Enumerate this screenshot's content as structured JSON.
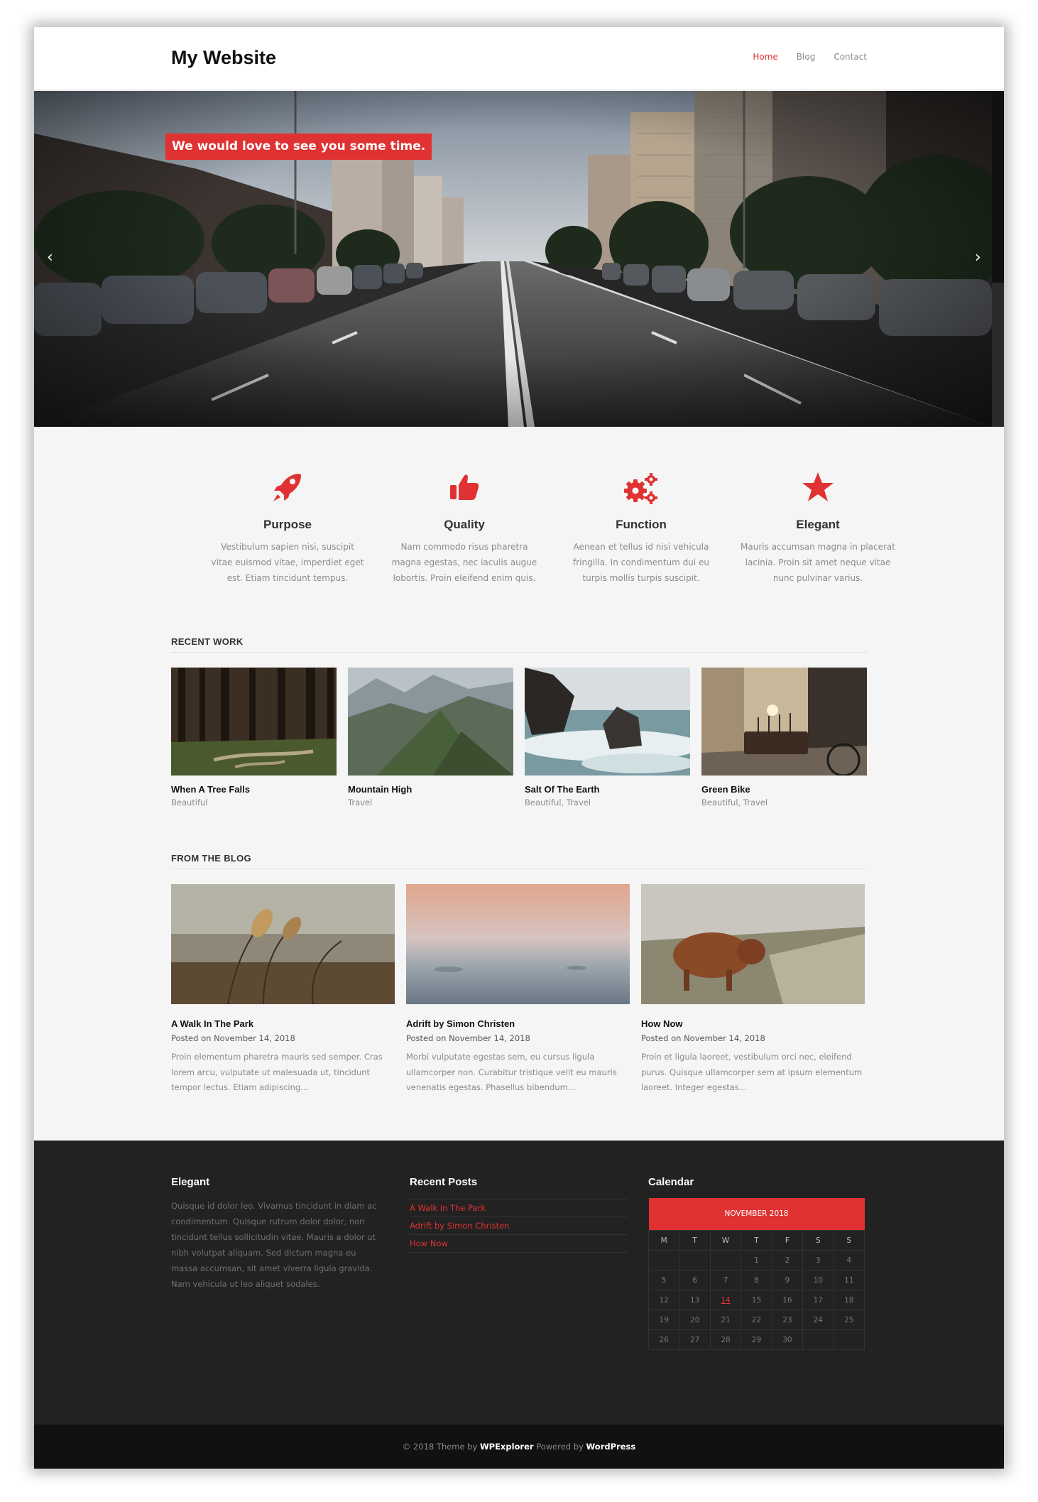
{
  "header": {
    "site_title": "My Website",
    "nav": [
      "Home",
      "Blog",
      "Contact"
    ]
  },
  "hero": {
    "caption": "We would love to see you some time.",
    "prev_icon": "chevron-left-icon",
    "next_icon": "chevron-right-icon"
  },
  "features": [
    {
      "icon": "rocket-icon",
      "title": "Purpose",
      "text": "Vestibulum sapien nisi, suscipit vitae euismod vitae, imperdiet eget est. Etiam tincidunt tempus."
    },
    {
      "icon": "thumbs-up-icon",
      "title": "Quality",
      "text": "Nam commodo risus pharetra magna egestas, nec iaculis augue lobortis. Proin eleifend enim quis."
    },
    {
      "icon": "gears-icon",
      "title": "Function",
      "text": "Aenean et tellus id nisi vehicula fringilla. In condimentum dui eu turpis mollis turpis suscipit."
    },
    {
      "icon": "star-icon",
      "title": "Elegant",
      "text": "Mauris accumsan magna in placerat lacinia. Proin sit amet neque vitae nunc pulvinar varius."
    }
  ],
  "recent_work": {
    "heading": "RECENT WORK",
    "items": [
      {
        "title": "When A Tree Falls",
        "cats": "Beautiful"
      },
      {
        "title": "Mountain High",
        "cats": "Travel"
      },
      {
        "title": "Salt Of The Earth",
        "cats": "Beautiful, Travel"
      },
      {
        "title": "Green Bike",
        "cats": "Beautiful, Travel"
      }
    ]
  },
  "blog": {
    "heading": "FROM THE BLOG",
    "posts": [
      {
        "title": "A Walk In The Park",
        "meta": "Posted on November 14, 2018",
        "excerpt": "Proin elementum pharetra mauris sed semper. Cras lorem arcu, vulputate ut malesuada ut, tincidunt tempor lectus. Etiam adipiscing..."
      },
      {
        "title": "Adrift by Simon Christen",
        "meta": "Posted on November 14, 2018",
        "excerpt": "Morbi vulputate egestas sem, eu cursus ligula ullamcorper non. Curabitur tristique velit eu mauris venenatis egestas. Phasellus bibendum..."
      },
      {
        "title": "How Now",
        "meta": "Posted on November 14, 2018",
        "excerpt": "Proin et ligula laoreet, vestibulum orci nec, eleifend purus. Quisque ullamcorper sem at ipsum elementum laoreet. Integer egestas..."
      }
    ]
  },
  "footer": {
    "about_title": "Elegant",
    "about_text": "Quisque id dolor leo. Vivamus tincidunt in diam ac condimentum. Quisque rutrum dolor dolor, non tincidunt tellus sollicitudin vitae. Mauris a dolor ut nibh volutpat aliquam. Sed dictum magna eu massa accumsan, sit amet viverra ligula gravida. Nam vehicula ut leo aliquet sodales.",
    "recent_title": "Recent Posts",
    "recent_posts": [
      "A Walk In The Park",
      "Adrift by Simon Christen",
      "How Now"
    ],
    "calendar_title": "Calendar",
    "calendar": {
      "month": "NOVEMBER 2018",
      "days": [
        "M",
        "T",
        "W",
        "T",
        "F",
        "S",
        "S"
      ],
      "weeks": [
        [
          "",
          "",
          "",
          "1",
          "2",
          "3",
          "4"
        ],
        [
          "5",
          "6",
          "7",
          "8",
          "9",
          "10",
          "11"
        ],
        [
          "12",
          "13",
          "14",
          "15",
          "16",
          "17",
          "18"
        ],
        [
          "19",
          "20",
          "21",
          "22",
          "23",
          "24",
          "25"
        ],
        [
          "26",
          "27",
          "28",
          "29",
          "30",
          "",
          ""
        ]
      ],
      "today": "14"
    },
    "credit_prefix": "© 2018 Theme by",
    "credit_theme": "WPExplorer",
    "credit_mid": "Powered by",
    "credit_wp": "WordPress"
  },
  "colors": {
    "accent": "#e03232",
    "footer_bg": "#222222",
    "bottom_bg": "#111111",
    "body_bg": "#f5f5f5"
  }
}
